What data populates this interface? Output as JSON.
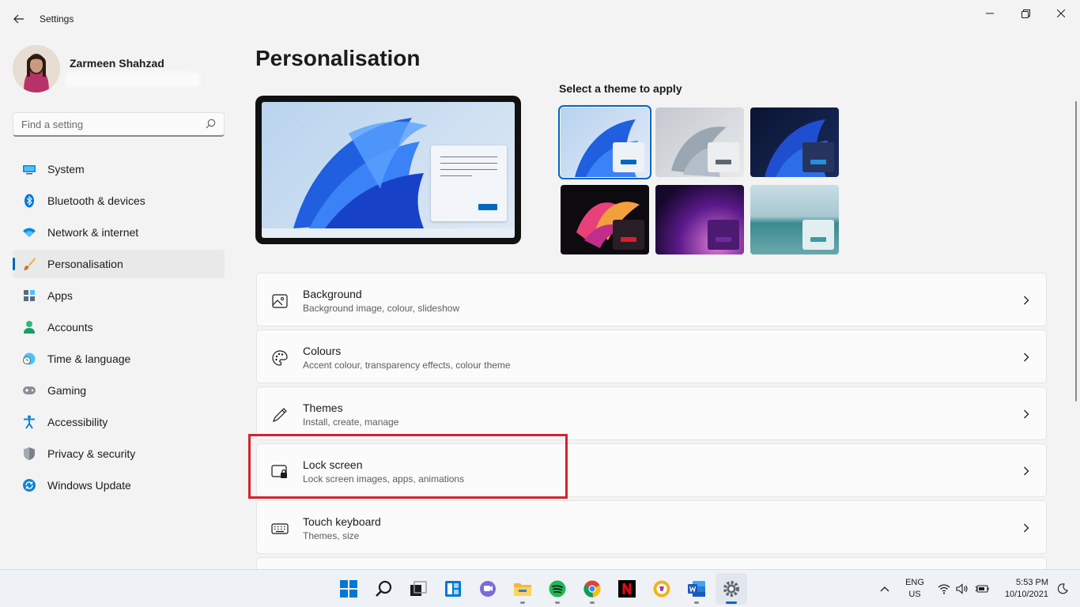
{
  "window": {
    "title": "Settings",
    "back_icon": "arrow-left-icon",
    "controls": [
      "minimize-icon",
      "maximize-icon",
      "close-icon"
    ]
  },
  "profile": {
    "name": "Zarmeen Shahzad"
  },
  "search": {
    "placeholder": "Find a setting",
    "value": ""
  },
  "sidebar": {
    "active_index": 3,
    "items": [
      {
        "label": "System",
        "icon": "monitor-icon"
      },
      {
        "label": "Bluetooth & devices",
        "icon": "bluetooth-icon"
      },
      {
        "label": "Network & internet",
        "icon": "wifi-icon"
      },
      {
        "label": "Personalisation",
        "icon": "paintbrush-icon"
      },
      {
        "label": "Apps",
        "icon": "apps-icon"
      },
      {
        "label": "Accounts",
        "icon": "person-icon"
      },
      {
        "label": "Time & language",
        "icon": "globe-clock-icon"
      },
      {
        "label": "Gaming",
        "icon": "gamepad-icon"
      },
      {
        "label": "Accessibility",
        "icon": "accessibility-icon"
      },
      {
        "label": "Privacy & security",
        "icon": "shield-icon"
      },
      {
        "label": "Windows Update",
        "icon": "update-icon"
      }
    ]
  },
  "main": {
    "title": "Personalisation",
    "theme_heading": "Select a theme to apply",
    "themes": [
      {
        "name": "windows-light",
        "selected": true
      },
      {
        "name": "glow",
        "selected": false
      },
      {
        "name": "windows-dark",
        "selected": false
      },
      {
        "name": "captured-motion",
        "selected": false
      },
      {
        "name": "sunrise",
        "selected": false
      },
      {
        "name": "flow",
        "selected": false
      }
    ],
    "cards": [
      {
        "title": "Background",
        "subtitle": "Background image, colour, slideshow",
        "icon": "image-icon"
      },
      {
        "title": "Colours",
        "subtitle": "Accent colour, transparency effects, colour theme",
        "icon": "palette-icon"
      },
      {
        "title": "Themes",
        "subtitle": "Install, create, manage",
        "icon": "pen-icon"
      },
      {
        "title": "Lock screen",
        "subtitle": "Lock screen images, apps, animations",
        "icon": "lock-screen-icon"
      },
      {
        "title": "Touch keyboard",
        "subtitle": "Themes, size",
        "icon": "keyboard-icon"
      }
    ],
    "highlighted_card": "Lock screen"
  },
  "taskbar": {
    "apps": [
      {
        "name": "start-icon",
        "running": false
      },
      {
        "name": "search-icon",
        "running": false
      },
      {
        "name": "task-view-icon",
        "running": false
      },
      {
        "name": "widgets-icon",
        "running": false
      },
      {
        "name": "teams-chat-icon",
        "running": false
      },
      {
        "name": "file-explorer-icon",
        "running": true
      },
      {
        "name": "spotify-icon",
        "running": true
      },
      {
        "name": "chrome-icon",
        "running": true
      },
      {
        "name": "netflix-icon",
        "running": false
      },
      {
        "name": "brave-browser-icon",
        "running": false
      },
      {
        "name": "word-icon",
        "running": true
      },
      {
        "name": "settings-app-icon",
        "running": true,
        "active": true
      }
    ],
    "language_line1": "ENG",
    "language_line2": "US",
    "time": "5:53 PM",
    "date": "10/10/2021"
  },
  "colors": {
    "accent": "#0067c0",
    "highlight_box": "#d0252e"
  }
}
